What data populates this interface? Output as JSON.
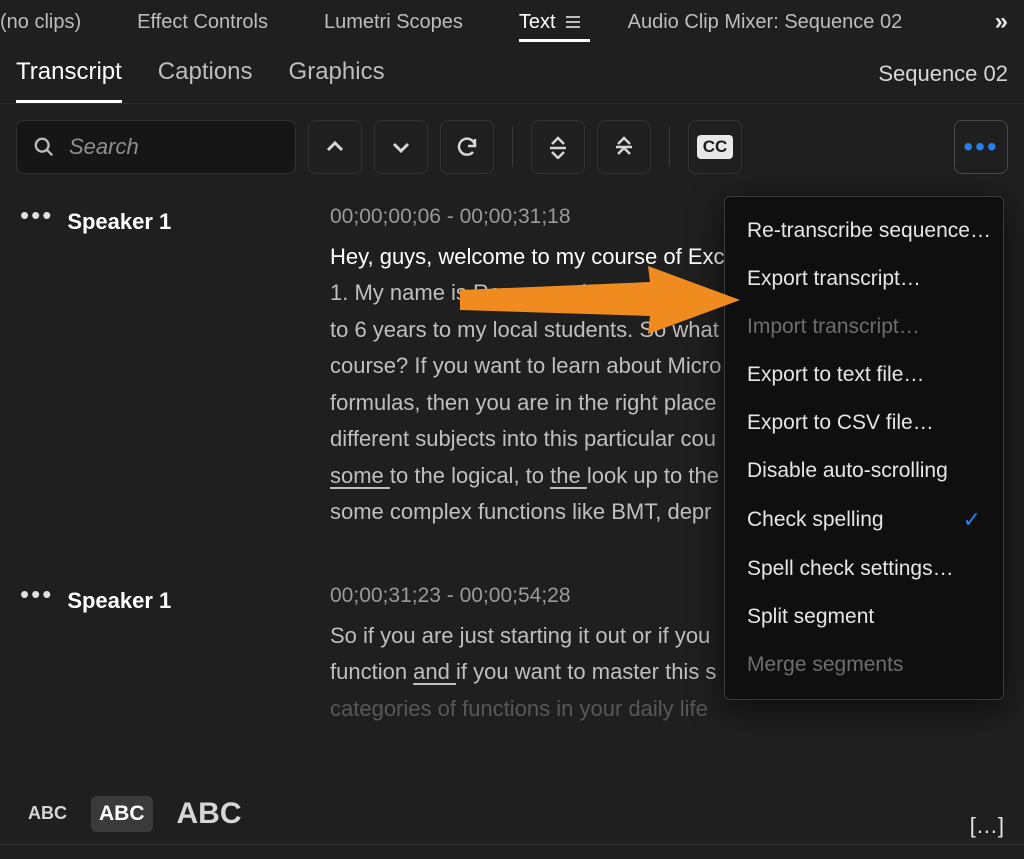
{
  "top_tabs": {
    "no_clips": "(no clips)",
    "effect_controls": "Effect Controls",
    "lumetri_scopes": "Lumetri Scopes",
    "text": "Text",
    "audio_mixer": "Audio Clip Mixer: Sequence 02",
    "more": "»"
  },
  "sub_tabs": {
    "transcript": "Transcript",
    "captions": "Captions",
    "graphics": "Graphics"
  },
  "sequence_label": "Sequence 02",
  "search": {
    "placeholder": "Search"
  },
  "cc_label": "CC",
  "segments": [
    {
      "speaker": "Speaker 1",
      "timecode": "00;00;00;06 - 00;00;31;18",
      "first_line": "Hey, guys, welcome to my course of Exc",
      "rest_a": "1. My name is Roman and I teach yo",
      "rest_b": "to 6 years to my local students. So what",
      "rest_c": "course? If you want to learn about Micro",
      "rest_d": "formulas, then you are in the right place",
      "rest_e": "different subjects into this particular cou",
      "rest_f_pre": "",
      "rest_f_some": "some ",
      "rest_f_mid": "to the logical, to ",
      "rest_f_the": "the ",
      "rest_f_end": "look up to the",
      "rest_g": "some complex functions like BMT, depr"
    },
    {
      "speaker": "Speaker 1",
      "timecode": "00;00;31;23 - 00;00;54;28",
      "line_a": "So if you are just starting it out or if you",
      "line_b_pre": "function ",
      "line_b_and": "and ",
      "line_b_end": "if you want to master this s",
      "line_c": "categories of functions in your daily life"
    }
  ],
  "menu": {
    "retranscribe": "Re-transcribe sequence…",
    "export_transcript": "Export transcript…",
    "import_transcript": "Import transcript…",
    "export_text": "Export to text file…",
    "export_csv": "Export to CSV file…",
    "disable_autoscroll": "Disable auto-scrolling",
    "check_spelling": "Check spelling",
    "spell_settings": "Spell check settings…",
    "split_segment": "Split segment",
    "merge_segments": "Merge segments"
  },
  "abc": {
    "s1": "ABC",
    "s2": "ABC",
    "s3": "ABC"
  },
  "corner": "[…]"
}
